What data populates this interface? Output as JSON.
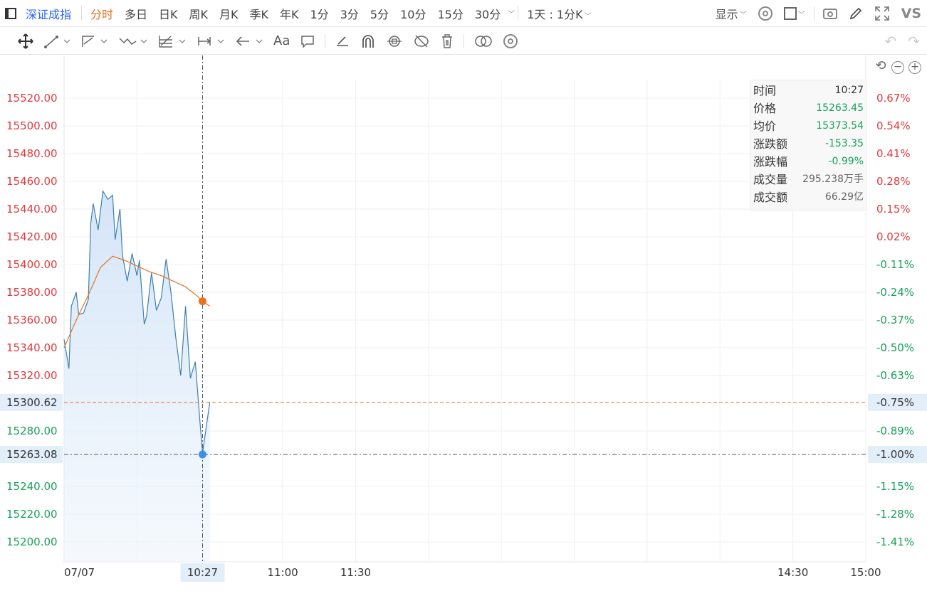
{
  "toolbar": {
    "symbol": "深证成指",
    "periods": [
      "分时",
      "多日",
      "日K",
      "周K",
      "月K",
      "季K",
      "年K",
      "1分",
      "3分",
      "5分",
      "10分",
      "15分",
      "30分"
    ],
    "active_period": "分时",
    "interval_label": "1天 : 1分K",
    "display_label": "显示",
    "vs_label": "VS"
  },
  "drawbar": {
    "text_tool": "Aa"
  },
  "info_panel": {
    "rows": [
      {
        "key": "时间",
        "value": "10:27",
        "color": "black"
      },
      {
        "key": "价格",
        "value": "15263.45",
        "color": "green"
      },
      {
        "key": "均价",
        "value": "15373.54",
        "color": "green"
      },
      {
        "key": "涨跌额",
        "value": "-153.35",
        "color": "green"
      },
      {
        "key": "涨跌幅",
        "value": "-0.99%",
        "color": "green"
      },
      {
        "key": "成交量",
        "value": "295.238万手",
        "color": "gray"
      },
      {
        "key": "成交额",
        "value": "66.29亿",
        "color": "gray"
      }
    ]
  },
  "colors": {
    "up": "#e03a3e",
    "down": "#18a058",
    "price_line": "#3d7fb1",
    "avg_line": "#e8711f",
    "crosshair": "#4d5566",
    "prev_close_line": "#e8711f",
    "highlight_label_bg": "#e3eefb"
  },
  "chart_data": {
    "type": "line",
    "prev_close": 15300.62,
    "ylim": [
      15190,
      15530
    ],
    "y_ticks": [
      "15520.00",
      "15500.00",
      "15480.00",
      "15460.00",
      "15440.00",
      "15420.00",
      "15400.00",
      "15380.00",
      "15360.00",
      "15340.00",
      "15320.00",
      "15300.62",
      "15280.00",
      "15263.08",
      "15240.00",
      "15220.00",
      "15200.00"
    ],
    "y_ticks_values": [
      15520,
      15500,
      15480,
      15460,
      15440,
      15420,
      15400,
      15380,
      15360,
      15340,
      15320,
      15300.62,
      15280,
      15263.08,
      15240,
      15220,
      15200
    ],
    "pct_ticks": [
      "0.67%",
      "0.54%",
      "0.41%",
      "0.28%",
      "0.15%",
      "0.02%",
      "-0.11%",
      "-0.24%",
      "-0.37%",
      "-0.50%",
      "-0.63%",
      "-0.75%",
      "-0.89%",
      "-1.00%",
      "-1.15%",
      "-1.28%",
      "-1.41%"
    ],
    "highlighted_y_ticks": [
      "15300.62",
      "15263.08"
    ],
    "highlighted_pct_ticks": [
      "-0.75%",
      "-1.00%"
    ],
    "x_labels": [
      "07/07",
      "10:27",
      "11:00",
      "11:30",
      "14:30",
      "15:00"
    ],
    "x_label_minutes": [
      0,
      57,
      90,
      120,
      300,
      330
    ],
    "highlighted_x_label": "10:27",
    "session_minutes": 330,
    "series": [
      {
        "name": "价格",
        "color": "#3d7fb1",
        "x_minutes": [
          0,
          2,
          3,
          5,
          6,
          8,
          10,
          11,
          12,
          14,
          16,
          18,
          20,
          21,
          23,
          24,
          26,
          28,
          30,
          31,
          33,
          34,
          36,
          38,
          40,
          42,
          44,
          46,
          48,
          50,
          52,
          54,
          56,
          57,
          60
        ],
        "values": [
          15346,
          15325,
          15370,
          15380,
          15364,
          15365,
          15375,
          15430,
          15444,
          15425,
          15453,
          15447,
          15450,
          15418,
          15440,
          15407,
          15388,
          15408,
          15392,
          15403,
          15357,
          15363,
          15394,
          15367,
          15376,
          15404,
          15380,
          15347,
          15320,
          15370,
          15318,
          15330,
          15285,
          15264,
          15301
        ]
      },
      {
        "name": "均价",
        "color": "#e8711f",
        "x_minutes": [
          0,
          5,
          10,
          15,
          20,
          25,
          30,
          35,
          40,
          45,
          50,
          55,
          57,
          60
        ],
        "values": [
          15340,
          15360,
          15378,
          15398,
          15406,
          15403,
          15399,
          15395,
          15392,
          15388,
          15384,
          15377,
          15373.5,
          15370
        ]
      }
    ],
    "crosshair": {
      "x_label": "10:27",
      "x_minute": 57,
      "y_label": "15263.08",
      "price_point": 15263.08,
      "avg_point": 15373.54
    }
  }
}
